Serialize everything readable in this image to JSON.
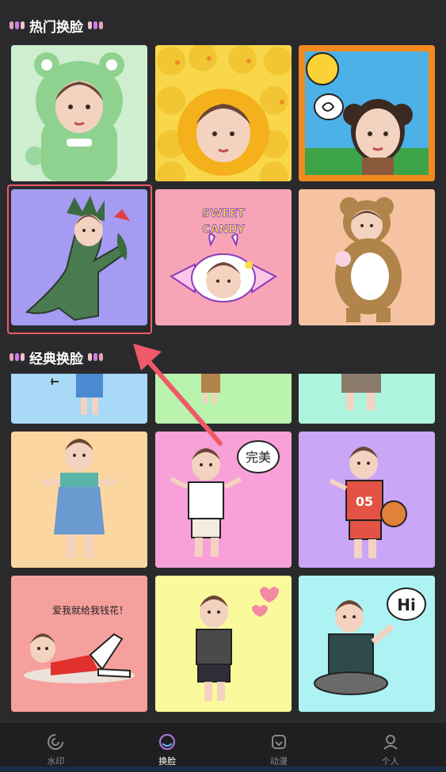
{
  "sections": {
    "hot": {
      "title": "热门换脸"
    },
    "classic": {
      "title": "经典换脸"
    }
  },
  "hot_cards": [
    {
      "name": "frog-hood",
      "bg": "#bfe9c2"
    },
    {
      "name": "duck-hood",
      "bg": "#f8d84a"
    },
    {
      "name": "bear-cartoon",
      "bg": "#f28a1f"
    },
    {
      "name": "dinosaur",
      "bg": "#a59bf2"
    },
    {
      "name": "sweet-candy",
      "bg": "#f7a5b6",
      "text": "SWEET CANDY"
    },
    {
      "name": "teddy-bear",
      "bg": "#f6c3a2"
    }
  ],
  "classic_cards": [
    {
      "name": "classic-1",
      "bg": "#a8d9f7"
    },
    {
      "name": "classic-2",
      "bg": "#b9f3ae"
    },
    {
      "name": "classic-3",
      "bg": "#aef3dd"
    },
    {
      "name": "overalls-girl",
      "bg": "#fcd6a0"
    },
    {
      "name": "perfect-girl",
      "bg": "#f8a0d8",
      "text": "完美"
    },
    {
      "name": "basketball-girl",
      "bg": "#c9a6f6",
      "text": "05"
    },
    {
      "name": "lying-girl",
      "bg": "#f5a09c",
      "text": "爱我就给我钱花！"
    },
    {
      "name": "uniform-girl",
      "bg": "#fafa9c"
    },
    {
      "name": "hi-girl",
      "bg": "#aef3f4",
      "text": "Hi"
    }
  ],
  "nav": [
    {
      "label": "水印",
      "icon": "watermark-icon",
      "active": false
    },
    {
      "label": "换脸",
      "icon": "face-swap-icon",
      "active": true
    },
    {
      "label": "动漫",
      "icon": "anime-icon",
      "active": false
    },
    {
      "label": "个人",
      "icon": "profile-icon",
      "active": false
    }
  ],
  "colors": {
    "background": "#2a2a2c",
    "highlight": "#f05a68",
    "nav_bg": "#1f1f21"
  }
}
